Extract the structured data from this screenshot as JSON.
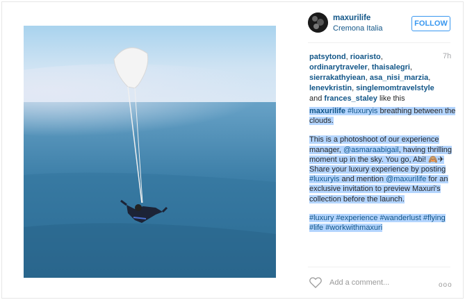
{
  "post": {
    "username": "maxurilife",
    "location": "Cremona Italia",
    "follow_label": "FOLLOW",
    "time": "7h",
    "likers": [
      "patsytond",
      "rioaristo",
      "ordinarytraveler",
      "thaisalegri",
      "sierrakathyiean",
      "asa_nisi_marzia",
      "lenevkristin",
      "singlemomtravelstyle"
    ],
    "likers_and": "and",
    "last_liker": "frances_staley",
    "likes_suffix": "like this",
    "caption": {
      "p1_user": "maxurilife",
      "p1_tag": "#luxuryis",
      "p1_text": "breathing between the clouds.",
      "p2_a": "This is a photoshoot of our experience manager,",
      "p2_mention": "@asmaraabigail",
      "p2_b": ", having thrilling moment up in the sky. You go, Abi!",
      "p2_emoji": "🙈✈",
      "p3_a": "Share your luxury experience by posting",
      "p3_tag": "#luxuryis",
      "p3_b": "and mention",
      "p3_mention": "@maxurilife",
      "p3_c": "for an exclusive invitation to preview Maxuri's collection before the launch.",
      "hashtags": [
        "#luxury",
        "#experience",
        "#wanderlust",
        "#flying",
        "#life",
        "#workwithmaxuri"
      ]
    },
    "comment_placeholder": "Add a comment...",
    "more_label": "ooo"
  }
}
